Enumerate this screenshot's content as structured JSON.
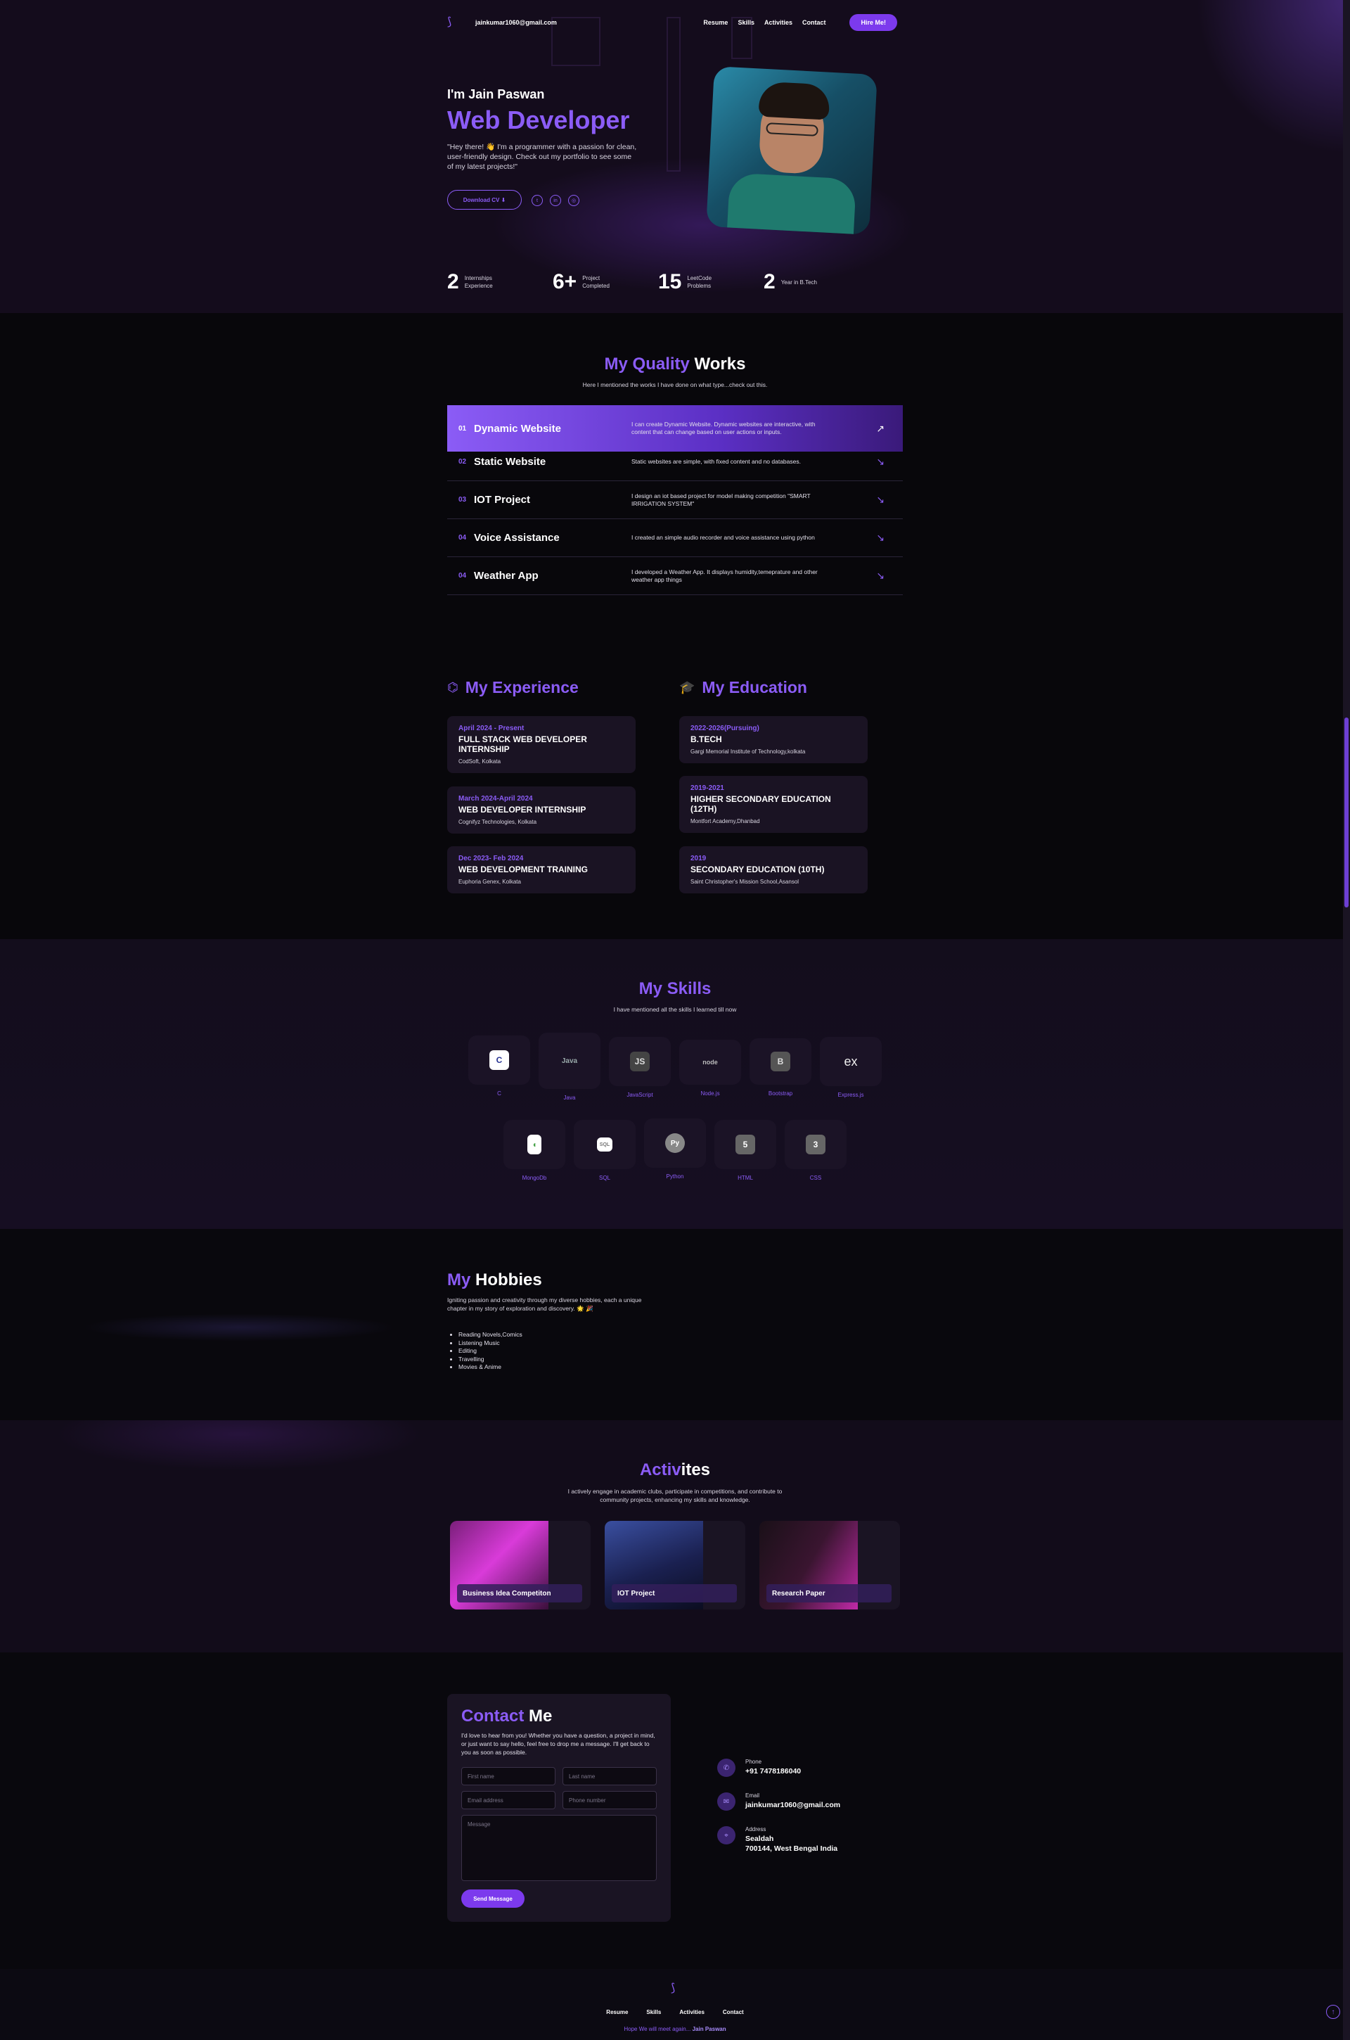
{
  "nav": {
    "email": "jainkumar1060@gmail.com",
    "links": [
      "Resume",
      "Skills",
      "Activities",
      "Contact"
    ],
    "hire_label": "Hire Me!"
  },
  "hero": {
    "greeting": "I'm Jain Paswan",
    "role": "Web Developer",
    "description": "\"Hey there! 👋 I'm a programmer with a passion for clean, user-friendly design. Check out my portfolio to see some of my latest projects!\"",
    "cv_label": "Download CV ⬇",
    "socials": [
      "twitter-icon",
      "linkedin-icon",
      "github-icon"
    ]
  },
  "stats": [
    {
      "num": "2",
      "label": "Internships Experience"
    },
    {
      "num": "6+",
      "label": "Project Completed"
    },
    {
      "num": "15",
      "label": "LeetCode Problems"
    },
    {
      "num": "2",
      "label": "Year in B.Tech"
    }
  ],
  "works": {
    "title_accent": "My Quality",
    "title_rest": "Works",
    "subtitle": "Here I mentioned the works I have done on what type...check out this.",
    "items": [
      {
        "num": "01",
        "title": "Dynamic Website",
        "desc": "I can create Dynamic Website. Dynamic websites are interactive, with content that can change based on user actions or inputs.",
        "arrow": "↗"
      },
      {
        "num": "02",
        "title": "Static Website",
        "desc": "Static websites are simple, with fixed content and no databases.",
        "arrow": "↘"
      },
      {
        "num": "03",
        "title": "IOT Project",
        "desc": "I design an iot based project for model making competition \"SMART IRRIGATION SYSTEM\"",
        "arrow": "↘"
      },
      {
        "num": "04",
        "title": "Voice Assistance",
        "desc": "I created an simple audio recorder and voice assistance using python",
        "arrow": "↘"
      },
      {
        "num": "04",
        "title": "Weather App",
        "desc": "I developed a Weather App. It displays humidity,temeprature and other weather app things",
        "arrow": "↘"
      }
    ]
  },
  "experience": {
    "title": "My Experience",
    "items": [
      {
        "date": "April 2024 - Present",
        "title": "FULL STACK WEB DEVELOPER INTERNSHIP",
        "place": "CodSoft, Kolkata"
      },
      {
        "date": "March 2024-April 2024",
        "title": "WEB DEVELOPER INTERNSHIP",
        "place": "Cognifyz Technologies, Kolkata"
      },
      {
        "date": "Dec 2023- Feb 2024",
        "title": "WEB DEVELOPMENT TRAINING",
        "place": "Euphoria Genex, Kolkata"
      }
    ]
  },
  "education": {
    "title": "My Education",
    "items": [
      {
        "date": "2022-2026(Pursuing)",
        "title": "B.TECH",
        "place": "Gargi Memorial Institute of Technology,kolkata"
      },
      {
        "date": "2019-2021",
        "title": "HIGHER SECONDARY EDUCATION (12TH)",
        "place": "Montfort Academy,Dhanbad"
      },
      {
        "date": "2019",
        "title": "SECONDARY EDUCATION (10TH)",
        "place": "Saint Christopher's Mission School,Asansol"
      }
    ]
  },
  "skills": {
    "title": "My Skills",
    "subtitle": "I have mentioned all the skills I learned till now",
    "row1": [
      {
        "label": "C",
        "glyph": "C"
      },
      {
        "label": "Java",
        "glyph": "Java"
      },
      {
        "label": "JavaScript",
        "glyph": "JS"
      },
      {
        "label": "Node.js",
        "glyph": "node"
      },
      {
        "label": "Bootstrap",
        "glyph": "B"
      },
      {
        "label": "Express.js",
        "glyph": "ex"
      }
    ],
    "row2": [
      {
        "label": "MongoDb",
        "glyph": "◖"
      },
      {
        "label": "SQL",
        "glyph": "SQL"
      },
      {
        "label": "Python",
        "glyph": "Py"
      },
      {
        "label": "HTML",
        "glyph": "5"
      },
      {
        "label": "CSS",
        "glyph": "3"
      }
    ]
  },
  "hobbies": {
    "title": "My Hobbies",
    "description": "Igniting passion and creativity through my diverse hobbies, each a unique chapter in my story of exploration and discovery. 🌟 🎉",
    "items": [
      "Reading Novels,Comics",
      "Listening Music",
      "Editing",
      "Travelling",
      "Movies & Anime"
    ]
  },
  "activities": {
    "title_accent": "Activ",
    "title_rest": "ites",
    "subtitle": "I actively engage in academic clubs, participate in competitions, and contribute to community projects, enhancing my skills and knowledge.",
    "cards": [
      "Business Idea Competiton",
      "IOT Project",
      "Research Paper"
    ]
  },
  "contact": {
    "title_accent": "Contact",
    "title_rest": "Me",
    "description": "I'd love to hear from you! Whether you have a question, a project in mind, or just want to say hello, feel free to drop me a message. I'll get back to you as soon as possible.",
    "fields": {
      "first": "First name",
      "last": "Last name",
      "email": "Email address",
      "phone": "Phone number",
      "message": "Message"
    },
    "send_label": "Send Message",
    "info": [
      {
        "label": "Phone",
        "value": "+91 7478186040",
        "icon": "phone-icon"
      },
      {
        "label": "Email",
        "value": "jainkumar1060@gmail.com",
        "icon": "mail-icon"
      },
      {
        "label": "Address",
        "value": "Sealdah\n700144, West Bengal India",
        "icon": "location-icon"
      }
    ]
  },
  "footer": {
    "links": [
      "Resume",
      "Skills",
      "Activities",
      "Contact"
    ],
    "note_prefix": "Hope We will meet again...",
    "note_name": "Jain Paswan"
  }
}
